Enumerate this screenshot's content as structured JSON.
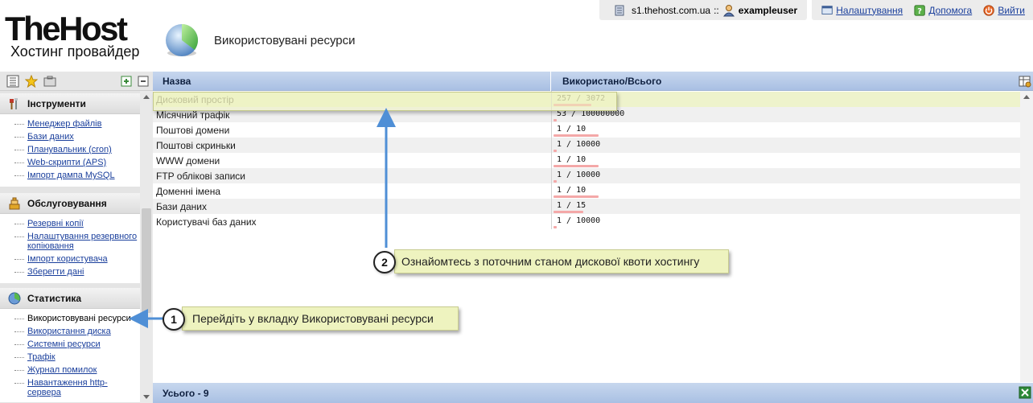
{
  "brand": {
    "name": "TheHost",
    "tagline": "Хостинг провайдер"
  },
  "page": {
    "title": "Використовувані ресурси"
  },
  "topbar": {
    "server": "s1.thehost.com.ua",
    "separator": "::",
    "username": "exampleuser",
    "links": [
      {
        "label": "Налаштування",
        "icon": "settings-icon"
      },
      {
        "label": "Допомога",
        "icon": "help-icon"
      },
      {
        "label": "Вийти",
        "icon": "power-icon"
      }
    ]
  },
  "sidebar": {
    "groups": [
      {
        "title": "Інструменти",
        "icon": "tools-icon",
        "items": [
          "Менеджер файлів",
          "Бази даних",
          "Планувальник (cron)",
          "Web-скрипти (APS)",
          "Імпорт дампа MySQL"
        ]
      },
      {
        "title": "Обслуговування",
        "icon": "service-icon",
        "items": [
          "Резервні копії",
          "Налаштування резервного копіювання",
          "Імпорт користувача",
          "Зберегти дані"
        ]
      },
      {
        "title": "Статистика",
        "icon": "stats-icon",
        "items": [
          "Використовувані ресурси",
          "Використання диска",
          "Системні ресурси",
          "Трафік",
          "Журнал помилок",
          "Навантаження http-сервера"
        ]
      }
    ]
  },
  "table": {
    "columns": [
      "Назва",
      "Використано/Всього"
    ],
    "rows": [
      {
        "name": "Дисковий простір",
        "value": "257 / 3072",
        "used": 257,
        "total": 3072
      },
      {
        "name": "Місячний трафік",
        "value": "53 / 100000000",
        "used": 53,
        "total": 100000000
      },
      {
        "name": "Поштові домени",
        "value": "1 / 10",
        "used": 1,
        "total": 10
      },
      {
        "name": "Поштові скриньки",
        "value": "1 / 10000",
        "used": 1,
        "total": 10000
      },
      {
        "name": "WWW домени",
        "value": "1 / 10",
        "used": 1,
        "total": 10
      },
      {
        "name": "FTP облікові записи",
        "value": "1 / 10000",
        "used": 1,
        "total": 10000
      },
      {
        "name": "Доменні імена",
        "value": "1 / 10",
        "used": 1,
        "total": 10
      },
      {
        "name": "Бази даних",
        "value": "1 / 15",
        "used": 1,
        "total": 15
      },
      {
        "name": "Користувачі баз даних",
        "value": "1 / 10000",
        "used": 1,
        "total": 10000
      }
    ],
    "footer": "Усього - 9"
  },
  "callouts": [
    {
      "number": "1",
      "text": "Перейдіть у вкладку Використовувані ресурси"
    },
    {
      "number": "2",
      "text": "Ознайомтесь з поточним станом дискової квоти хостингу"
    }
  ],
  "colors": {
    "header_blue": "#b3c8e8",
    "link": "#1a3f9c",
    "callout_bg": "#eef3bf",
    "usage_bar": "#f4a8a8"
  }
}
